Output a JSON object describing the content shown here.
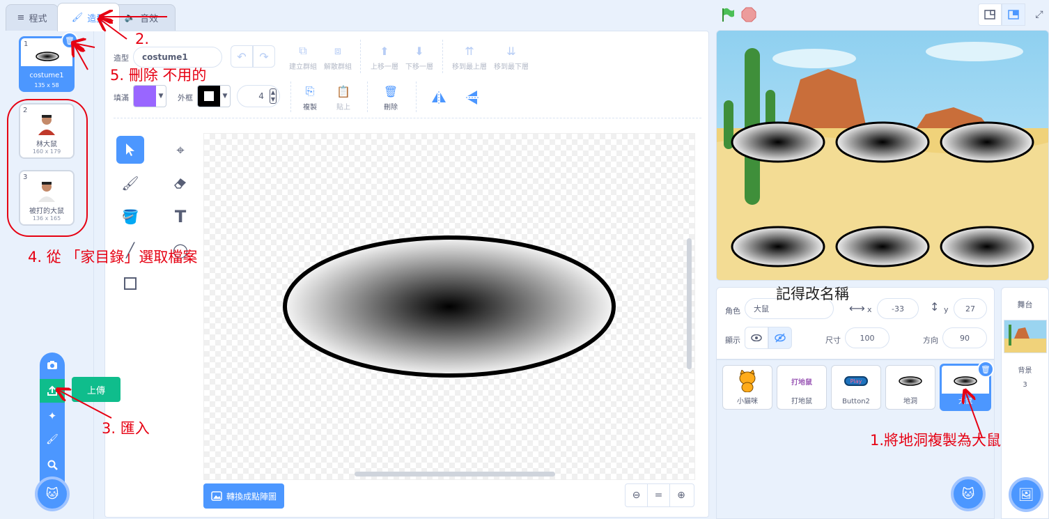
{
  "tabs": [
    {
      "label": "程式",
      "icon": "code-icon"
    },
    {
      "label": "造型",
      "icon": "brush-icon"
    },
    {
      "label": "音效",
      "icon": "speaker-icon"
    }
  ],
  "costumes": [
    {
      "num": "1",
      "name": "costume1",
      "size": "135 x 58"
    },
    {
      "num": "2",
      "name": "林大鼠",
      "size": "160 x 179"
    },
    {
      "num": "3",
      "name": "被打的大鼠",
      "size": "136 x 165"
    }
  ],
  "editor": {
    "costume_label": "造型",
    "costume_name": "costume1",
    "fill_label": "填滿",
    "outline_label": "外框",
    "outline_width": "4",
    "fill_color": "#9966ff",
    "outline_color": "#000000",
    "toolbar": {
      "group": "建立群組",
      "ungroup": "解散群組",
      "forward": "上移一層",
      "backward": "下移一層",
      "front": "移到最上層",
      "back": "移到最下層",
      "copy": "複製",
      "paste": "貼上",
      "delete": "刪除"
    },
    "convert_button": "轉換成點陣圖",
    "zoom_reset": "="
  },
  "upload_tooltip": "上傳",
  "sprite_info": {
    "sprite_label": "角色",
    "sprite_name": "大鼠",
    "x_label": "x",
    "x_value": "-33",
    "y_label": "y",
    "y_value": "27",
    "show_label": "顯示",
    "size_label": "尺寸",
    "size_value": "100",
    "direction_label": "方向",
    "direction_value": "90"
  },
  "sprites": [
    {
      "name": "小貓咪"
    },
    {
      "name": "打地鼠",
      "thumb_text": "打地鼠"
    },
    {
      "name": "Button2",
      "thumb_text": "Play"
    },
    {
      "name": "地洞"
    },
    {
      "name": "大鼠"
    }
  ],
  "stage_panel": {
    "title": "舞台",
    "backdrop_label": "背景",
    "backdrop_count": "3"
  },
  "annotations": {
    "a1": "1.將地洞複製為大鼠",
    "a2": "2.",
    "a3": "3.  匯入",
    "a4": "4.  從 「家目錄」選取檔案",
    "a5": "5.  刪除  不用的",
    "a6": "記得改名稱"
  },
  "colors": {
    "accent": "#4c97ff",
    "annotation": "#e60012",
    "upload_green": "#0fbd8c"
  }
}
